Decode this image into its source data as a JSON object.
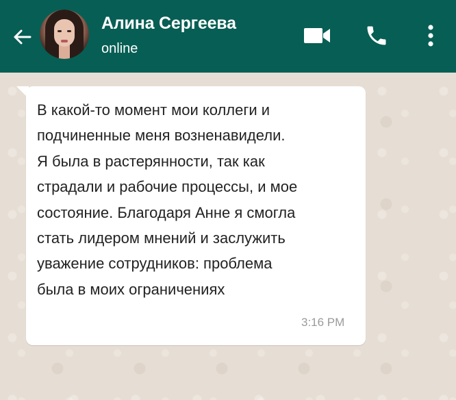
{
  "header": {
    "contact_name": "Алина Сергеева",
    "status": "online",
    "colors": {
      "background": "#075e54",
      "text": "#ffffff"
    },
    "icons": [
      "back-arrow-icon",
      "video-call-icon",
      "phone-icon",
      "more-vertical-icon"
    ]
  },
  "message": {
    "lines": [
      "В какой-то момент мои коллеги и",
      "подчиненные меня возненавидели.",
      "Я была в растерянности, так как",
      "страдали и рабочие процессы, и мое",
      "состояние. Благодаря Анне я смогла",
      "стать лидером мнений и заслужить",
      "уважение сотрудников: проблема",
      "была в моих ограничениях"
    ],
    "time": "3:16 PM",
    "bubble_color": "#ffffff"
  },
  "chat": {
    "background_color": "#e6ded4"
  }
}
